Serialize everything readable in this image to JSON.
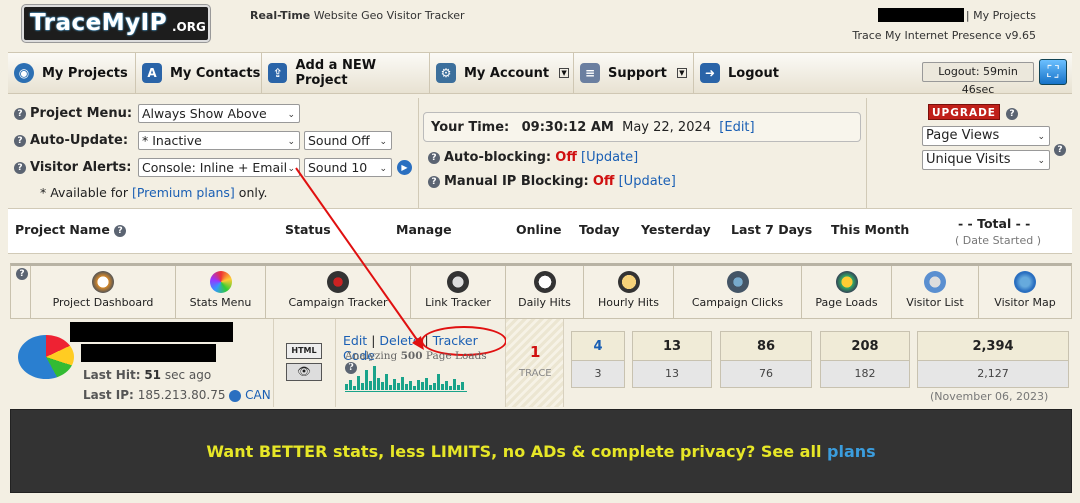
{
  "header": {
    "logo_main": "TraceMyIP",
    "logo_org": ".ORG",
    "tagline_bold": "Real-Time",
    "tagline_rest": "Website Geo Visitor Tracker",
    "my_projects_link": "| My Projects",
    "version": "Trace My Internet Presence v9.65"
  },
  "nav": {
    "items": [
      {
        "label": "My Projects",
        "icon": "globe-icon"
      },
      {
        "label": "My Contacts",
        "icon": "address-book-icon"
      },
      {
        "label": "Add a NEW Project",
        "icon": "upload-icon"
      },
      {
        "label": "My Account",
        "icon": "gears-icon"
      },
      {
        "label": "Support",
        "icon": "document-icon"
      },
      {
        "label": "Logout",
        "icon": "logout-arrow-icon"
      }
    ],
    "logout_timer": "Logout: 59min 46sec"
  },
  "settings": {
    "project_menu_label": "Project Menu:",
    "project_menu_value": "Always Show Above",
    "auto_update_label": "Auto-Update:",
    "auto_update_value": "* Inactive",
    "sound_value": "Sound Off",
    "visitor_alerts_label": "Visitor Alerts:",
    "visitor_alerts_value": "Console: Inline + Email",
    "sound_level_value": "Sound 10",
    "premium_note_pre": "* Available for",
    "premium_note_link": "[Premium plans]",
    "premium_note_post": "only."
  },
  "time": {
    "label": "Your Time:",
    "clock": "09:30:12 AM",
    "date": "May 22, 2024",
    "edit": "[Edit]",
    "auto_blocking_label": "Auto-blocking:",
    "auto_blocking_value": "Off",
    "auto_blocking_update": "[Update]",
    "manual_blocking_label": "Manual IP Blocking:",
    "manual_blocking_value": "Off",
    "manual_blocking_update": "[Update]"
  },
  "upgrade": {
    "button": "UPGRADE",
    "select1": "Page Views",
    "select2": "Unique Visits"
  },
  "table": {
    "headers": {
      "project_name": "Project Name",
      "status": "Status",
      "manage": "Manage",
      "online": "Online",
      "today": "Today",
      "yesterday": "Yesterday",
      "last7": "Last 7 Days",
      "this_month": "This Month",
      "total": "- - Total - -",
      "date_started": "( Date Started )"
    }
  },
  "tools": [
    {
      "label": "Project Dashboard",
      "icon": "dashboard-icon"
    },
    {
      "label": "Stats Menu",
      "icon": "color-wheel-icon"
    },
    {
      "label": "Campaign Tracker",
      "icon": "campaign-icon"
    },
    {
      "label": "Link Tracker",
      "icon": "link-icon"
    },
    {
      "label": "Daily Hits",
      "icon": "calendar-icon"
    },
    {
      "label": "Hourly Hits",
      "icon": "clock-icon"
    },
    {
      "label": "Campaign Clicks",
      "icon": "target-icon"
    },
    {
      "label": "Page Loads",
      "icon": "page-load-icon"
    },
    {
      "label": "Visitor List",
      "icon": "visitor-icon"
    },
    {
      "label": "Visitor Map",
      "icon": "globe-map-icon"
    }
  ],
  "project": {
    "last_hit_label": "Last Hit:",
    "last_hit_value": "51",
    "last_hit_unit": "sec ago",
    "last_ip_label": "Last IP:",
    "last_ip_value": "185.213.80.75",
    "country": "CAN",
    "edit": "Edit",
    "delete": "Delete",
    "tracker_code": "Tracker Code",
    "analyzing_pre": "Analyzing",
    "analyzing_num": "500",
    "analyzing_post": "Page Loads",
    "online_count": "1",
    "trace_label": "TRACE",
    "stats": {
      "today_top": "4",
      "today_bot": "3",
      "yesterday_top": "13",
      "yesterday_bot": "13",
      "last7_top": "86",
      "last7_bot": "76",
      "month_top": "208",
      "month_bot": "182",
      "total_top": "2,394",
      "total_bot": "2,127",
      "date_started": "(November 06, 2023)"
    }
  },
  "banner": {
    "text": "Want BETTER stats, less LIMITS, no ADs & complete privacy? See all",
    "link": "plans"
  }
}
